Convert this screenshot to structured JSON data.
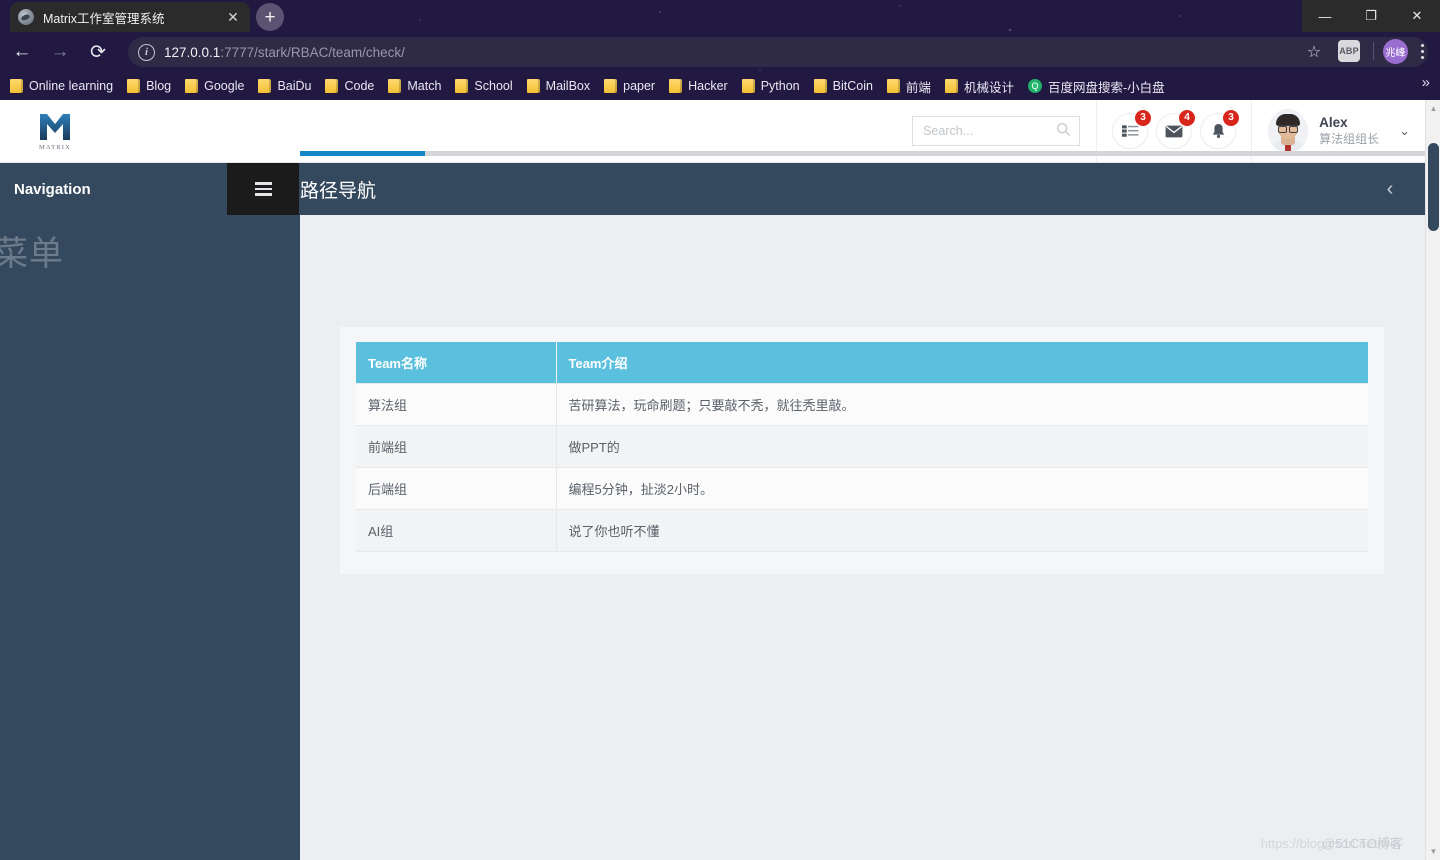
{
  "browser": {
    "tab": {
      "title": "Matrix工作室管理系统",
      "favicon": "globe-icon",
      "close": "✕"
    },
    "new_tab": "+",
    "window_controls": {
      "minimize": "—",
      "restore": "❐",
      "close": "✕"
    },
    "nav": {
      "back": "←",
      "forward": "→",
      "reload": "⟳"
    },
    "omnibox": {
      "info_icon": "ⓘ",
      "host": "127.0.0.1",
      "rest": ":7777/stark/RBAC/team/check/",
      "full_url": "127.0.0.1:7777/stark/RBAC/team/check/"
    },
    "star_icon": "☆",
    "extension_label": "ABP",
    "profile_label": "兆峰",
    "bookmarks": [
      {
        "label": "Online learning",
        "icon": "folder-icon"
      },
      {
        "label": "Blog",
        "icon": "folder-icon"
      },
      {
        "label": "Google",
        "icon": "folder-icon"
      },
      {
        "label": "BaiDu",
        "icon": "folder-icon"
      },
      {
        "label": "Code",
        "icon": "folder-icon"
      },
      {
        "label": "Match",
        "icon": "folder-icon"
      },
      {
        "label": "School",
        "icon": "folder-icon"
      },
      {
        "label": "MailBox",
        "icon": "folder-icon"
      },
      {
        "label": "paper",
        "icon": "folder-icon"
      },
      {
        "label": "Hacker",
        "icon": "folder-icon"
      },
      {
        "label": "Python",
        "icon": "folder-icon"
      },
      {
        "label": "BitCoin",
        "icon": "folder-icon"
      },
      {
        "label": "前端",
        "icon": "folder-icon"
      },
      {
        "label": "机械设计",
        "icon": "folder-icon"
      },
      {
        "label": "百度网盘搜索-小白盘",
        "icon": "search-engine-icon"
      }
    ],
    "bookmarks_overflow": "»"
  },
  "app": {
    "brand": {
      "mark": "M",
      "word": "MATRIX"
    },
    "search": {
      "value": "",
      "placeholder": "Search...",
      "icon": "search-icon"
    },
    "icons": [
      {
        "name": "tasks-icon",
        "badge": "3"
      },
      {
        "name": "mail-icon",
        "badge": "4"
      },
      {
        "name": "bell-icon",
        "badge": "3"
      }
    ],
    "user": {
      "name": "Alex",
      "role": "算法组组长",
      "caret": "⌄"
    }
  },
  "navbar": {
    "sidebar_title": "Navigation",
    "hamburger": "menu-icon",
    "page_tab": "路径导航",
    "collapse_icon": "‹"
  },
  "sidebar": {
    "watermark_text": "菜单"
  },
  "table": {
    "columns": [
      "Team名称",
      "Team介绍"
    ],
    "rows": [
      {
        "name": "算法组",
        "intro": "苦研算法，玩命刷题；只要敲不秃，就往秃里敲。"
      },
      {
        "name": "前端组",
        "intro": "做PPT的"
      },
      {
        "name": "后端组",
        "intro": "编程5分钟，扯淡2小时。"
      },
      {
        "name": "AI组",
        "intro": "说了你也听不懂"
      }
    ]
  },
  "watermark": {
    "line1": "https://blog.csdn.net/wei",
    "line2": "@51CTO博客"
  },
  "colors": {
    "navbar": "#35495e",
    "accent_underline": "#1787c9",
    "table_header": "#5bc0de",
    "badge": "#d9261c",
    "browser_chrome": "#221943"
  }
}
